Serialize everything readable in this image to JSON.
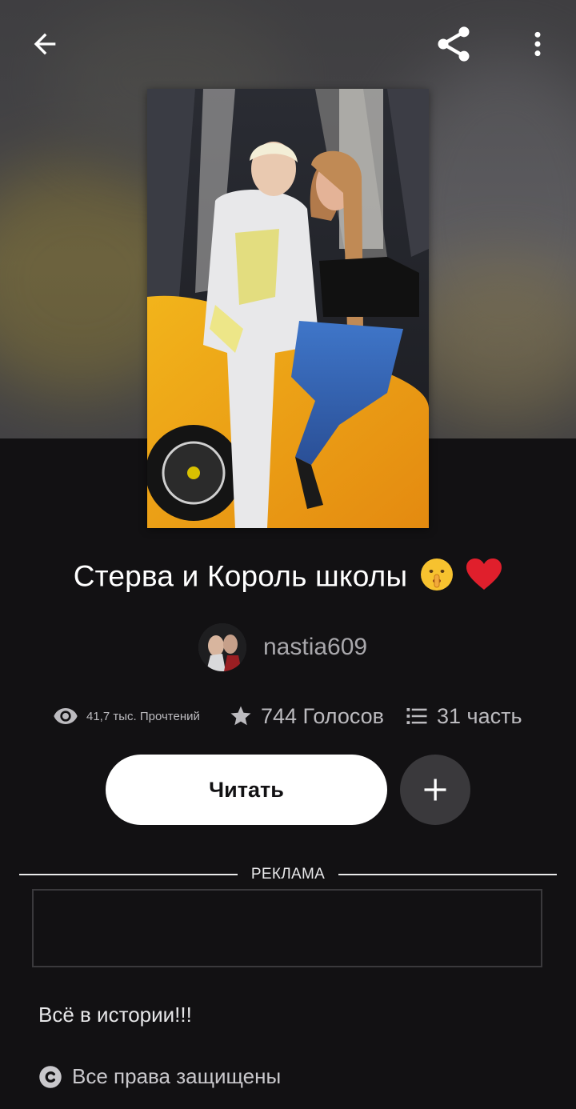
{
  "nav": {
    "back_icon": "arrow-left-icon",
    "share_icon": "share-icon",
    "more_icon": "more-vertical-icon"
  },
  "story": {
    "title": "Стерва и Король школы",
    "title_emojis": [
      "shushing-face-emoji",
      "red-heart-emoji"
    ],
    "author": "nastia609"
  },
  "stats": {
    "reads": "41,7 тыс. Прочтений",
    "votes": "744 Голосов",
    "parts": "31 часть"
  },
  "actions": {
    "read_label": "Читать",
    "add_icon": "plus-icon"
  },
  "ad": {
    "label": "РЕКЛАМА"
  },
  "description": {
    "text": "Всё в истории!!!",
    "copyright": "Все права защищены"
  },
  "colors": {
    "background": "#121113",
    "read_button": "#ffffff",
    "add_button": "#3a393c",
    "muted_text": "#a9a8ac"
  }
}
